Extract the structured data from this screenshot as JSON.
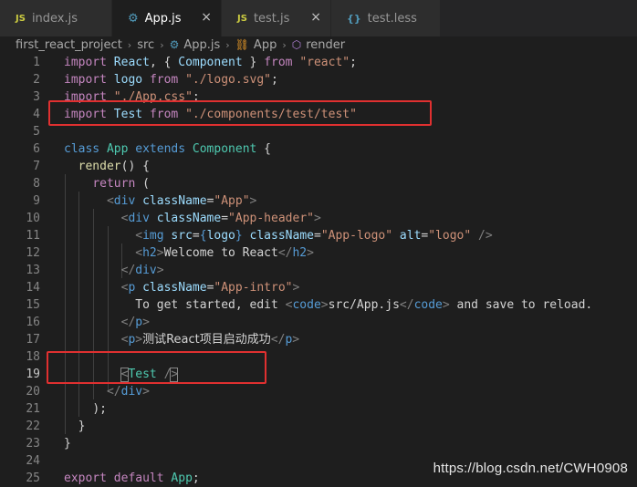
{
  "tabs": [
    {
      "icon": "JS",
      "label": "index.js",
      "active": false,
      "close": ""
    },
    {
      "icon": "⚙",
      "label": "App.js",
      "active": true,
      "close": "×"
    },
    {
      "icon": "JS",
      "label": "test.js",
      "active": false,
      "close": "×"
    },
    {
      "icon": "{}",
      "label": "test.less",
      "active": false,
      "close": ""
    }
  ],
  "breadcrumb": [
    "first_react_project",
    "src",
    "App.js",
    "App",
    "render"
  ],
  "watermark": "https://blog.csdn.net/CWH0908",
  "line_numbers": [
    "1",
    "2",
    "3",
    "4",
    "5",
    "6",
    "7",
    "8",
    "9",
    "10",
    "11",
    "12",
    "13",
    "14",
    "15",
    "16",
    "17",
    "18",
    "19",
    "20",
    "21",
    "22",
    "23",
    "24",
    "25"
  ],
  "code": {
    "l1": [
      "import",
      "React",
      ", { ",
      "Component",
      " } ",
      "from",
      "\"react\"",
      ";"
    ],
    "l2": [
      "import",
      "logo",
      "from",
      "\"./logo.svg\"",
      ";"
    ],
    "l3": [
      "import",
      "\"./App.css\"",
      ";"
    ],
    "l4": [
      "import",
      "Test",
      "from",
      "\"./components/test/test\""
    ],
    "l6": [
      "class",
      "App",
      "extends",
      "Component",
      " {"
    ],
    "l7": [
      "render",
      "() {"
    ],
    "l8": [
      "return",
      " ("
    ],
    "l9": [
      "<",
      "div",
      "className",
      "=",
      "\"App\"",
      ">"
    ],
    "l10": [
      "<",
      "div",
      "className",
      "=",
      "\"App-header\"",
      ">"
    ],
    "l11": [
      "<",
      "img",
      "src",
      "=",
      "{",
      "logo",
      "}",
      "className",
      "=",
      "\"App-logo\"",
      "alt",
      "=",
      "\"logo\"",
      " />"
    ],
    "l12": [
      "<",
      "h2",
      ">",
      "Welcome to React",
      "</",
      "h2",
      ">"
    ],
    "l13": [
      "</",
      "div",
      ">"
    ],
    "l14": [
      "<",
      "p",
      "className",
      "=",
      "\"App-intro\"",
      ">"
    ],
    "l15": [
      "To get started, edit ",
      "<",
      "code",
      ">",
      "src/App.js",
      "</",
      "code",
      ">",
      " and save to reload."
    ],
    "l16": [
      "</",
      "p",
      ">"
    ],
    "l17": [
      "<",
      "p",
      ">",
      "测试React项目启动成功",
      "</",
      "p",
      ">"
    ],
    "l19": [
      "<",
      "Test",
      " />"
    ],
    "l20": [
      "</",
      "div",
      ">"
    ],
    "l21": [
      ");"
    ],
    "l22": [
      "}"
    ],
    "l23": [
      "}"
    ],
    "l25": [
      "export",
      "default",
      "App",
      ";"
    ]
  },
  "colors": {
    "background": "#1e1e1e",
    "keyword_purple": "#c586c0",
    "keyword_blue": "#569cd6",
    "variable": "#9cdcfe",
    "string": "#ce9178",
    "class": "#4ec9b0",
    "function": "#dcdcaa",
    "highlight_box": "#e03030"
  }
}
